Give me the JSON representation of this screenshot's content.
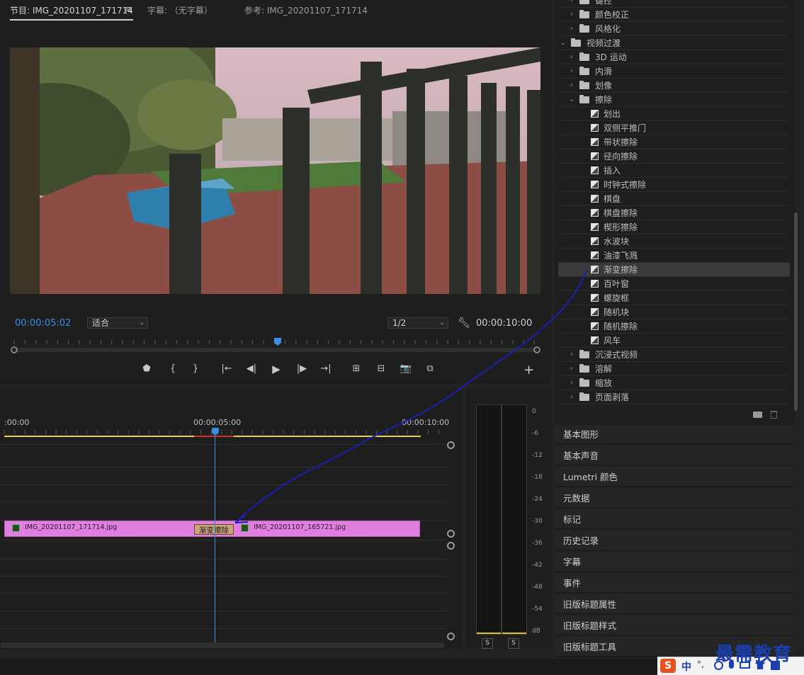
{
  "program_monitor": {
    "tabs": [
      {
        "label": "节目: IMG_20201107_171714",
        "active": true
      },
      {
        "label": "字幕: （无字幕）",
        "active": false
      },
      {
        "label": "参考: IMG_20201107_171714",
        "active": false
      }
    ],
    "menu_icon": "hamburger-icon",
    "current_timecode": "00:00:05:02",
    "zoom_select": "适合",
    "resolution_select": "1/2",
    "duration_timecode": "00:00:10:00",
    "settings_icon": "wrench-icon",
    "controls": [
      {
        "name": "add-marker-button",
        "icon": "marker-icon",
        "glyph": "⬟"
      },
      {
        "name": "mark-in-button",
        "icon": "mark-in-icon",
        "glyph": "{"
      },
      {
        "name": "mark-out-button",
        "icon": "mark-out-icon",
        "glyph": "}"
      },
      {
        "name": "go-to-in-button",
        "icon": "go-to-in-icon",
        "glyph": "|←"
      },
      {
        "name": "step-back-button",
        "icon": "step-back-icon",
        "glyph": "◀|"
      },
      {
        "name": "play-button",
        "icon": "play-icon",
        "glyph": "▶"
      },
      {
        "name": "step-forward-button",
        "icon": "step-forward-icon",
        "glyph": "|▶"
      },
      {
        "name": "go-to-out-button",
        "icon": "go-to-out-icon",
        "glyph": "→|"
      },
      {
        "name": "lift-button",
        "icon": "lift-icon",
        "glyph": "⊞"
      },
      {
        "name": "extract-button",
        "icon": "extract-icon",
        "glyph": "⊟"
      },
      {
        "name": "export-frame-button",
        "icon": "camera-icon",
        "glyph": "📷"
      },
      {
        "name": "comparison-view-button",
        "icon": "comparison-icon",
        "glyph": "⧉"
      }
    ],
    "add_button_glyph": "+"
  },
  "timeline": {
    "ruler_labels": [
      ":00:00",
      "00:00:05:00",
      "00:00:10:00"
    ],
    "clips": [
      {
        "name": "IMG_20201107_171714.jpg"
      },
      {
        "name": "IMG_20201107_165721.jpg"
      }
    ],
    "transition_label": "渐变擦除",
    "clip_color": "#e07fe0",
    "playhead_color": "#3a8ee6",
    "work_area_color": "#e8d53c"
  },
  "audio_meter": {
    "scale": [
      "0",
      "-6",
      "-12",
      "-18",
      "-24",
      "-30",
      "-36",
      "-42",
      "-48",
      "-54",
      "dB"
    ],
    "solo_buttons": [
      "S",
      "S"
    ]
  },
  "effects_tree": {
    "items": [
      {
        "label": "键控",
        "type": "folder",
        "level": 1,
        "expanded": false
      },
      {
        "label": "颜色校正",
        "type": "folder",
        "level": 1,
        "expanded": false
      },
      {
        "label": "风格化",
        "type": "folder",
        "level": 1,
        "expanded": false
      },
      {
        "label": "视频过渡",
        "type": "folder",
        "level": 0,
        "expanded": true
      },
      {
        "label": "3D 运动",
        "type": "folder",
        "level": 1,
        "expanded": false
      },
      {
        "label": "内滑",
        "type": "folder",
        "level": 1,
        "expanded": false
      },
      {
        "label": "划像",
        "type": "folder",
        "level": 1,
        "expanded": false
      },
      {
        "label": "擦除",
        "type": "folder",
        "level": 1,
        "expanded": true
      },
      {
        "label": "划出",
        "type": "effect",
        "level": 2
      },
      {
        "label": "双侧平推门",
        "type": "effect",
        "level": 2
      },
      {
        "label": "带状擦除",
        "type": "effect",
        "level": 2
      },
      {
        "label": "径向擦除",
        "type": "effect",
        "level": 2
      },
      {
        "label": "插入",
        "type": "effect",
        "level": 2
      },
      {
        "label": "时钟式擦除",
        "type": "effect",
        "level": 2
      },
      {
        "label": "棋盘",
        "type": "effect",
        "level": 2
      },
      {
        "label": "棋盘擦除",
        "type": "effect",
        "level": 2
      },
      {
        "label": "楔形擦除",
        "type": "effect",
        "level": 2
      },
      {
        "label": "水波块",
        "type": "effect",
        "level": 2
      },
      {
        "label": "油漆飞溅",
        "type": "effect",
        "level": 2
      },
      {
        "label": "渐变擦除",
        "type": "effect",
        "level": 2,
        "selected": true
      },
      {
        "label": "百叶窗",
        "type": "effect",
        "level": 2
      },
      {
        "label": "螺旋框",
        "type": "effect",
        "level": 2
      },
      {
        "label": "随机块",
        "type": "effect",
        "level": 2
      },
      {
        "label": "随机擦除",
        "type": "effect",
        "level": 2
      },
      {
        "label": "风车",
        "type": "effect",
        "level": 2
      },
      {
        "label": "沉浸式视频",
        "type": "folder",
        "level": 1,
        "expanded": false
      },
      {
        "label": "溶解",
        "type": "folder",
        "level": 1,
        "expanded": false
      },
      {
        "label": "缩放",
        "type": "folder",
        "level": 1,
        "expanded": false
      },
      {
        "label": "页面剥落",
        "type": "folder",
        "level": 1,
        "expanded": false
      }
    ]
  },
  "panels": [
    "基本图形",
    "基本声音",
    "Lumetri 颜色",
    "元数据",
    "标记",
    "历史记录",
    "字幕",
    "事件",
    "旧版标题属性",
    "旧版标题样式",
    "旧版标题工具"
  ],
  "watermark": "最需教育",
  "ime_bar": {
    "label": "中",
    "punct": "°,"
  },
  "colors": {
    "accent": "#3a8ee6",
    "annotation_arrow": "#1b1fb0"
  }
}
